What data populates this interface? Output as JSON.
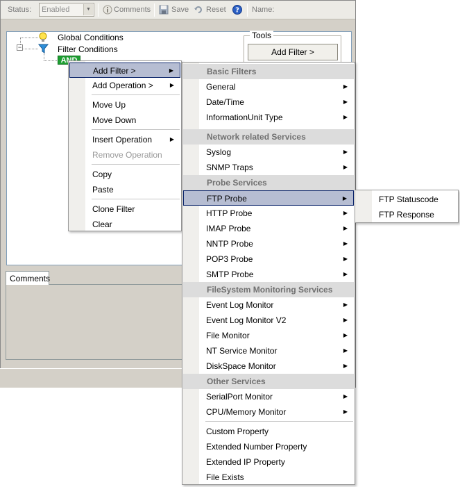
{
  "toolbar": {
    "status_label": "Status:",
    "status_value": "Enabled",
    "comments_label": "Comments",
    "save_label": "Save",
    "reset_label": "Reset",
    "name_label": "Name:"
  },
  "tree": {
    "global_conditions": "Global Conditions",
    "filter_conditions": "Filter Conditions",
    "and_node": "AND"
  },
  "tools": {
    "group_label": "Tools",
    "add_filter_button": "Add Filter >"
  },
  "comments_tab": "Comments",
  "context_menu": {
    "items": [
      {
        "label": "Add Filter >"
      },
      {
        "label": "Add Operation >"
      },
      {
        "label": "Move Up"
      },
      {
        "label": "Move Down"
      },
      {
        "label": "Insert Operation"
      },
      {
        "label": "Remove Operation"
      },
      {
        "label": "Copy"
      },
      {
        "label": "Paste"
      },
      {
        "label": "Clone Filter"
      },
      {
        "label": "Clear"
      }
    ]
  },
  "filter_menu": {
    "headers": [
      "Basic Filters",
      "Network related Services",
      "Probe Services",
      "FileSystem Monitoring Services",
      "Other Services"
    ],
    "items": [
      {
        "label": "General"
      },
      {
        "label": "Date/Time"
      },
      {
        "label": "InformationUnit Type"
      },
      {
        "label": "Syslog"
      },
      {
        "label": "SNMP Traps"
      },
      {
        "label": "FTP Probe"
      },
      {
        "label": "HTTP Probe"
      },
      {
        "label": "IMAP Probe"
      },
      {
        "label": "NNTP Probe"
      },
      {
        "label": "POP3 Probe"
      },
      {
        "label": "SMTP Probe"
      },
      {
        "label": "Event Log Monitor"
      },
      {
        "label": "Event Log Monitor V2"
      },
      {
        "label": "File Monitor"
      },
      {
        "label": "NT Service Monitor"
      },
      {
        "label": "DiskSpace Monitor"
      },
      {
        "label": "SerialPort Monitor"
      },
      {
        "label": "CPU/Memory Monitor"
      },
      {
        "label": "Custom Property"
      },
      {
        "label": "Extended Number Property"
      },
      {
        "label": "Extended IP Property"
      },
      {
        "label": "File Exists"
      }
    ]
  },
  "ftp_menu": {
    "items": [
      {
        "label": "FTP Statuscode"
      },
      {
        "label": "FTP Response"
      }
    ]
  },
  "colors": {
    "highlight": "#b6bdd2",
    "and_badge": "#1e9e32",
    "section_header": "#dcdcdc"
  }
}
